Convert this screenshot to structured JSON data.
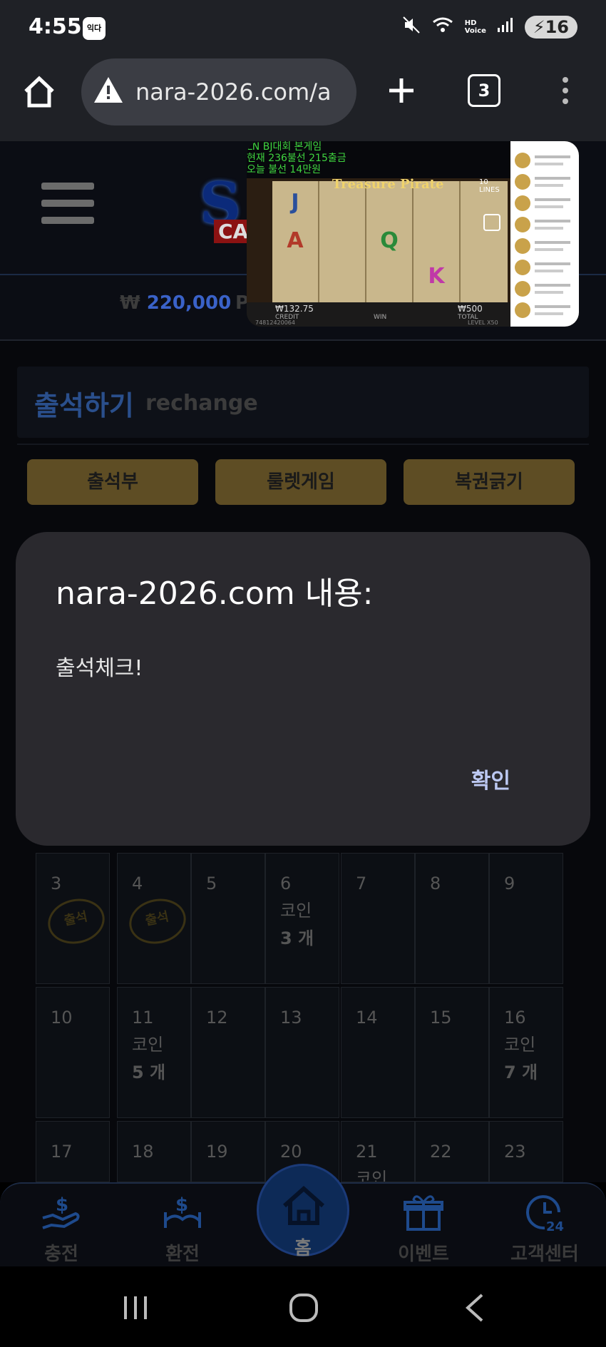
{
  "status": {
    "time": "4:55",
    "app_badge": "익다",
    "battery": "16",
    "hd_voice": "HD Voice"
  },
  "browser": {
    "url": "nara-2026.com/a",
    "tab_count": "3"
  },
  "site": {
    "balance": "220,000",
    "currency_symbol": "₩",
    "attend_title": "출석하기",
    "attend_sub": "rechange",
    "buttons": [
      "출석부",
      "룰렛게임",
      "복권긁기"
    ]
  },
  "overlay": {
    "lines": [
      "LN BJ대회 본게임",
      "현재 236불선 215출금",
      "오늘 불선 14만원"
    ],
    "game_title": "Treasure Pirate",
    "credit": "₩132.75",
    "credit_label": "CREDIT",
    "win_label": "WIN",
    "total": "₩500",
    "total_label": "TOTAL",
    "game_id": "74812420064",
    "level": "LEVEL X50",
    "lines_badge": "10 LINES",
    "symbols": [
      "J",
      "A",
      "K",
      "Q"
    ]
  },
  "calendar": {
    "rows": [
      [
        {
          "day": "3",
          "stamp": "출석"
        },
        {
          "day": "4",
          "stamp": "출석"
        },
        {
          "day": "5"
        },
        {
          "day": "6",
          "coin": "코인",
          "count": "3 개"
        },
        {
          "day": "7"
        },
        {
          "day": "8"
        },
        {
          "day": "9"
        }
      ],
      [
        {
          "day": "10"
        },
        {
          "day": "11",
          "coin": "코인",
          "count": "5 개"
        },
        {
          "day": "12"
        },
        {
          "day": "13"
        },
        {
          "day": "14"
        },
        {
          "day": "15"
        },
        {
          "day": "16",
          "coin": "코인",
          "count": "7 개"
        }
      ],
      [
        {
          "day": "17"
        },
        {
          "day": "18"
        },
        {
          "day": "19"
        },
        {
          "day": "20"
        },
        {
          "day": "21",
          "coin": "코인"
        },
        {
          "day": "22"
        },
        {
          "day": "23"
        }
      ]
    ]
  },
  "bottom_nav": {
    "charge": "충전",
    "exchange": "환전",
    "home": "홈",
    "event": "이벤트",
    "support": "고객센터"
  },
  "dialog": {
    "title": "nara-2026.com 내용:",
    "message": "출석체크!",
    "ok": "확인"
  },
  "colors": {
    "accent_gold": "#5e4d24",
    "dialog_bg": "#2a292e",
    "ok_text": "#bcc8f2",
    "brand_blue": "#3a62c8"
  }
}
